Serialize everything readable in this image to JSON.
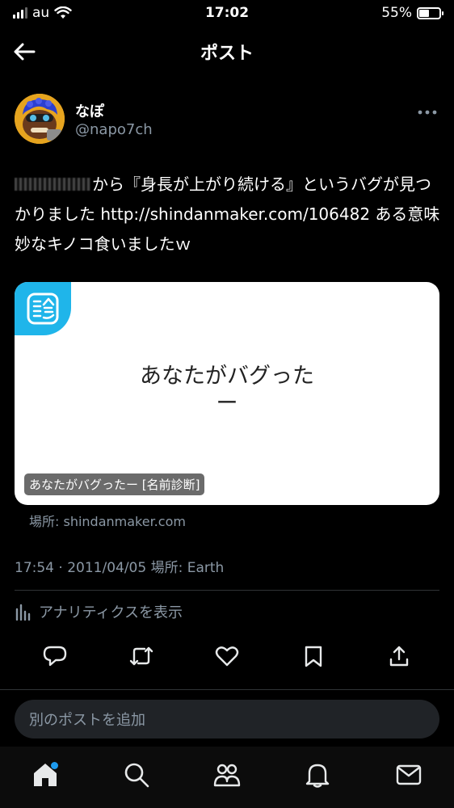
{
  "status_bar": {
    "carrier": "au",
    "time": "17:02",
    "battery_percent": "55%",
    "battery_level": 0.55
  },
  "header": {
    "title": "ポスト"
  },
  "post": {
    "author": {
      "display_name": "なぽ",
      "handle": "@napo7ch"
    },
    "text": "から『身長が上がり続ける』というバグが見つかりました http://shindanmaker.com/106482 ある意味妙なキノコ食いましたｗ",
    "card": {
      "title_line1": "あなたがバグった",
      "title_line2": "ー",
      "caption": "あなたがバグったー [名前診断]",
      "domain": "場所: shindanmaker.com"
    },
    "timestamp": "17:54 · 2011/04/05 場所: Earth",
    "analytics_label": "アナリティクスを表示"
  },
  "reply": {
    "placeholder": "別のポストを追加"
  },
  "colors": {
    "background": "#000000",
    "muted_text": "#8b98a5",
    "accent": "#1d9bf0",
    "card_badge": "#1fb5ea"
  },
  "icons": {
    "back": "arrow-left-icon",
    "more": "more-horizontal-icon",
    "reply": "comment-icon",
    "repost": "repost-icon",
    "like": "heart-icon",
    "bookmark": "bookmark-icon",
    "share": "share-icon",
    "analytics": "bar-chart-icon",
    "tabs": [
      "home-icon",
      "search-icon",
      "communities-icon",
      "bell-icon",
      "mail-icon"
    ]
  }
}
